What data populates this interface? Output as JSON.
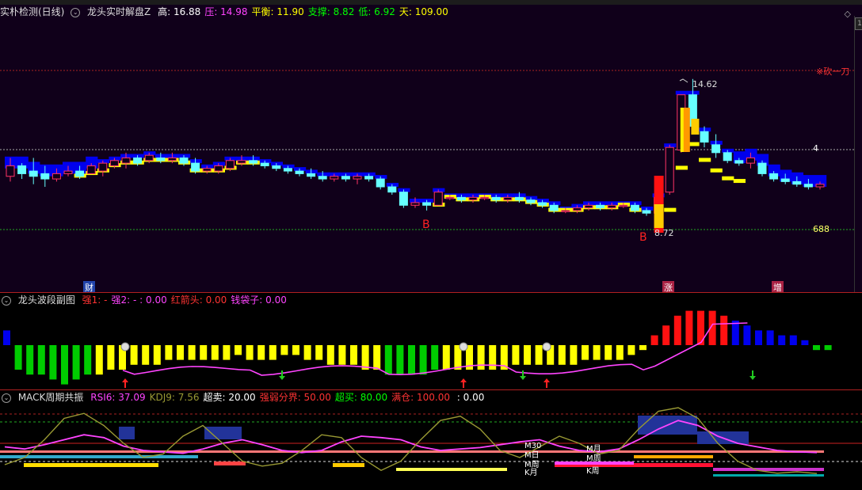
{
  "main_panel": {
    "header": {
      "indicator": "实朴检测(日线)",
      "formula": "龙头实时解盘Z",
      "items": [
        {
          "label": "高:",
          "value": "16.88",
          "color": "#ffffff"
        },
        {
          "label": "压:",
          "value": "14.98",
          "color": "#ff44ff"
        },
        {
          "label": "平衡:",
          "value": "11.90",
          "color": "#ffff00"
        },
        {
          "label": "支撑:",
          "value": "8.82",
          "color": "#00ff00"
        },
        {
          "label": "低:",
          "value": "6.92",
          "color": "#00ff00"
        },
        {
          "label": "天:",
          "value": "109.00",
          "color": "#ffff00"
        }
      ]
    },
    "right_labels": {
      "kan": "※砍一刀",
      "four": "4",
      "six88": "688"
    },
    "annotations": {
      "high_price": "14.62",
      "low_price": "8.72",
      "buy_marker": "B"
    },
    "event_tags": [
      "财",
      "涨",
      "增"
    ],
    "scroll_label": "1"
  },
  "wave_panel": {
    "header": {
      "name": "龙头波段副图",
      "items": [
        {
          "label": "强1:",
          "value": "-",
          "color": "#ff3333"
        },
        {
          "label": "强2:",
          "value": "- : 0.00",
          "color": "#ff44ff"
        },
        {
          "label": "红箭头:",
          "value": "0.00",
          "color": "#ff3333"
        },
        {
          "label": "钱袋子:",
          "value": "0.00",
          "color": "#ff44ff"
        }
      ]
    }
  },
  "mack_panel": {
    "header": {
      "name": "MACK周期共振",
      "items": [
        {
          "label": "RSI6:",
          "value": "37.09",
          "color": "#ff44ff"
        },
        {
          "label": "KDJ9:",
          "value": "7.56",
          "color": "#999933"
        },
        {
          "label": "超卖:",
          "value": "20.00",
          "color": "#ffffff"
        },
        {
          "label": "强弱分界:",
          "value": "50.00",
          "color": "#ff3333"
        },
        {
          "label": "超买:",
          "value": "80.00",
          "color": "#00ff00"
        },
        {
          "label": "满仓:",
          "value": "100.00",
          "color": "#ff3333"
        },
        {
          "label": "",
          "value": ": 0.00",
          "color": "#ffffff"
        }
      ]
    },
    "cycle_labels": [
      "M30",
      "M日",
      "M周",
      "K月",
      "M月",
      "M周",
      "K周"
    ]
  },
  "colors": {
    "up": "#ff3366",
    "down": "#66ffff",
    "cloud": "#0000ee",
    "yellow": "#ffff00",
    "red": "#ff1111",
    "green": "#00cc00"
  },
  "chart_data": [
    {
      "type": "candlestick",
      "title": "实朴检测(日线)",
      "reference_levels": {
        "high": 16.88,
        "pressure": 14.98,
        "balance": 11.9,
        "support": 8.82,
        "low": 6.92
      },
      "annotated_high": 14.62,
      "annotated_low": 8.72,
      "ohlc": [
        [
          10.9,
          11.6,
          10.7,
          11.3
        ],
        [
          11.3,
          11.4,
          10.8,
          11.0
        ],
        [
          11.1,
          11.6,
          10.6,
          10.9
        ],
        [
          11.0,
          11.3,
          10.5,
          10.8
        ],
        [
          10.8,
          11.2,
          10.7,
          11.0
        ],
        [
          11.0,
          11.3,
          10.9,
          11.1
        ],
        [
          11.1,
          11.3,
          10.8,
          10.9
        ],
        [
          11.0,
          11.4,
          11.0,
          11.3
        ],
        [
          11.1,
          11.5,
          10.9,
          11.4
        ],
        [
          11.3,
          11.6,
          11.2,
          11.5
        ],
        [
          11.4,
          11.8,
          11.2,
          11.6
        ],
        [
          11.6,
          11.7,
          11.3,
          11.4
        ],
        [
          11.5,
          11.8,
          11.4,
          11.7
        ],
        [
          11.6,
          11.8,
          11.4,
          11.5
        ],
        [
          11.5,
          11.8,
          11.4,
          11.6
        ],
        [
          11.6,
          11.7,
          11.3,
          11.4
        ],
        [
          11.4,
          11.6,
          11.0,
          11.1
        ],
        [
          11.1,
          11.3,
          11.0,
          11.2
        ],
        [
          11.1,
          11.4,
          11.0,
          11.3
        ],
        [
          11.2,
          11.6,
          11.1,
          11.5
        ],
        [
          11.4,
          11.7,
          11.3,
          11.5
        ],
        [
          11.5,
          11.7,
          11.3,
          11.4
        ],
        [
          11.4,
          11.5,
          11.2,
          11.3
        ],
        [
          11.3,
          11.4,
          11.1,
          11.2
        ],
        [
          11.2,
          11.3,
          11.0,
          11.1
        ],
        [
          11.1,
          11.2,
          10.9,
          11.0
        ],
        [
          11.0,
          11.2,
          10.8,
          10.9
        ],
        [
          10.9,
          11.1,
          10.7,
          10.8
        ],
        [
          10.8,
          11.0,
          10.7,
          10.9
        ],
        [
          10.9,
          11.0,
          10.7,
          10.8
        ],
        [
          10.8,
          11.0,
          10.6,
          10.9
        ],
        [
          10.9,
          11.0,
          10.7,
          10.8
        ],
        [
          10.8,
          10.9,
          10.4,
          10.5
        ],
        [
          10.5,
          10.6,
          10.2,
          10.3
        ],
        [
          10.3,
          10.4,
          9.7,
          9.8
        ],
        [
          9.8,
          10.1,
          9.7,
          9.9
        ],
        [
          9.9,
          10.0,
          9.6,
          9.8
        ],
        [
          9.8,
          10.4,
          9.8,
          10.3
        ],
        [
          10.1,
          10.2,
          10.0,
          10.1
        ],
        [
          10.1,
          10.2,
          9.9,
          10.0
        ],
        [
          10.0,
          10.2,
          9.9,
          10.1
        ],
        [
          10.1,
          10.2,
          10.0,
          10.1
        ],
        [
          10.1,
          10.2,
          9.9,
          10.0
        ],
        [
          10.0,
          10.2,
          9.9,
          10.1
        ],
        [
          10.1,
          10.3,
          9.9,
          10.0
        ],
        [
          10.0,
          10.1,
          9.8,
          9.9
        ],
        [
          9.9,
          10.0,
          9.7,
          9.8
        ],
        [
          9.8,
          9.9,
          9.5,
          9.6
        ],
        [
          9.6,
          9.7,
          9.5,
          9.6
        ],
        [
          9.6,
          9.8,
          9.5,
          9.7
        ],
        [
          9.7,
          9.9,
          9.6,
          9.8
        ],
        [
          9.8,
          9.9,
          9.6,
          9.7
        ],
        [
          9.7,
          9.9,
          9.6,
          9.8
        ],
        [
          9.8,
          9.9,
          9.7,
          9.8
        ],
        [
          9.8,
          9.9,
          9.5,
          9.6
        ],
        [
          9.6,
          9.7,
          9.4,
          9.5
        ],
        [
          9.5,
          10.2,
          9.0,
          10.1
        ],
        [
          10.3,
          12.1,
          10.2,
          12.0
        ],
        [
          11.9,
          14.0,
          11.8,
          14.0
        ],
        [
          14.0,
          14.6,
          12.7,
          12.8
        ],
        [
          12.6,
          12.8,
          12.0,
          12.2
        ],
        [
          12.1,
          12.5,
          11.6,
          11.8
        ],
        [
          11.8,
          11.9,
          11.4,
          11.5
        ],
        [
          11.5,
          11.6,
          11.3,
          11.4
        ],
        [
          11.4,
          11.8,
          11.2,
          11.6
        ],
        [
          11.4,
          11.5,
          10.9,
          11.0
        ],
        [
          11.0,
          11.1,
          10.7,
          10.8
        ],
        [
          10.8,
          11.0,
          10.6,
          10.7
        ],
        [
          10.7,
          10.9,
          10.5,
          10.6
        ],
        [
          10.6,
          10.8,
          10.4,
          10.5
        ],
        [
          10.5,
          10.7,
          10.4,
          10.6
        ]
      ]
    },
    {
      "type": "bar",
      "title": "龙头波段副图",
      "values": [
        3,
        -5,
        -6,
        -6,
        -7,
        -8,
        -7,
        -6,
        -6,
        -5,
        -5,
        -4,
        -4,
        -4,
        -3,
        -3,
        -3,
        -3,
        -3,
        -3,
        -2,
        -3,
        -3,
        -3,
        -2,
        -2,
        -3,
        -3,
        -4,
        -4,
        -4,
        -5,
        -5,
        -6,
        -6,
        -6,
        -6,
        -5,
        -5,
        -5,
        -5,
        -5,
        -5,
        -5,
        -4,
        -4,
        -4,
        -4,
        -4,
        -4,
        -3,
        -3,
        -3,
        -3,
        -2,
        -1,
        2,
        4,
        6,
        7,
        7,
        7,
        6,
        5,
        4,
        3,
        3,
        2,
        2,
        1,
        -1,
        -1
      ]
    },
    {
      "type": "line",
      "title": "MACK周期共振",
      "series": [
        {
          "name": "RSI6",
          "values": [
            45,
            42,
            48,
            55,
            62,
            58,
            46,
            40,
            38,
            36,
            42,
            50,
            55,
            48,
            40,
            37,
            40,
            52,
            60,
            58,
            55,
            45,
            40,
            42,
            44,
            48,
            52,
            55,
            46,
            40,
            38,
            42,
            55,
            70,
            82,
            75,
            60,
            50,
            45,
            40,
            38,
            37
          ]
        },
        {
          "name": "KDJ9",
          "values": [
            20,
            30,
            55,
            85,
            92,
            75,
            50,
            30,
            35,
            60,
            75,
            50,
            25,
            18,
            22,
            40,
            62,
            58,
            30,
            12,
            25,
            55,
            82,
            88,
            70,
            40,
            30,
            45,
            60,
            50,
            35,
            40,
            70,
            95,
            100,
            85,
            50,
            25,
            12,
            8,
            10,
            7.56
          ]
        }
      ],
      "levels": [
        20,
        50,
        80,
        100
      ]
    }
  ]
}
